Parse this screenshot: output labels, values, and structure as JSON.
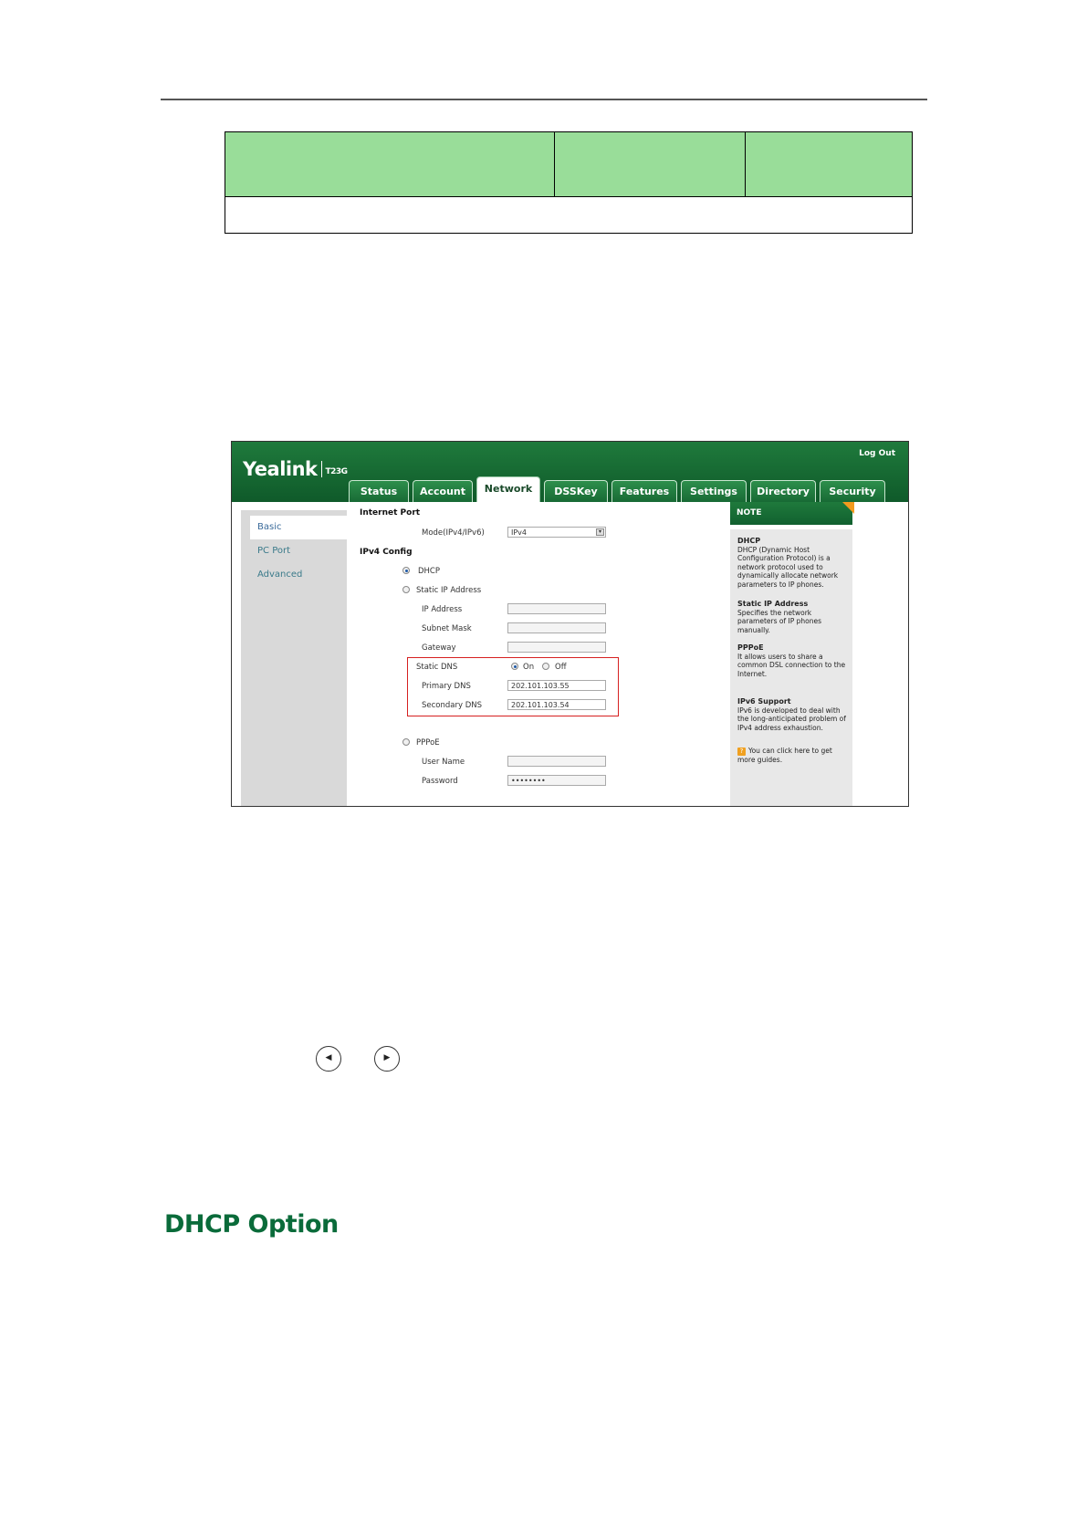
{
  "header_logo": {
    "brand": "Yealink",
    "model": "T23G"
  },
  "header": {
    "logout_label": "Log Out"
  },
  "tabs": [
    {
      "label": "Status"
    },
    {
      "label": "Account"
    },
    {
      "label": "Network"
    },
    {
      "label": "DSSKey"
    },
    {
      "label": "Features"
    },
    {
      "label": "Settings"
    },
    {
      "label": "Directory"
    },
    {
      "label": "Security"
    }
  ],
  "active_tab": "Network",
  "sidebar": {
    "items": [
      {
        "label": "Basic"
      },
      {
        "label": "PC Port"
      },
      {
        "label": "Advanced"
      }
    ]
  },
  "form": {
    "internet_port_label": "Internet Port",
    "mode_label": "Mode(IPv4/IPv6)",
    "mode_value": "IPv4",
    "ipv4_config_label": "IPv4 Config",
    "dhcp_label": "DHCP",
    "static_ip_label": "Static IP Address",
    "ip_address_label": "IP Address",
    "subnet_mask_label": "Subnet Mask",
    "gateway_label": "Gateway",
    "static_dns_label": "Static DNS",
    "on_label": "On",
    "off_label": "Off",
    "primary_dns_label": "Primary DNS",
    "primary_dns_value": "202.101.103.55",
    "secondary_dns_label": "Secondary DNS",
    "secondary_dns_value": "202.101.103.54",
    "pppoe_label": "PPPoE",
    "user_name_label": "User Name",
    "password_label": "Password",
    "password_value": "••••••••"
  },
  "note": {
    "title": "NOTE",
    "dhcp_title": "DHCP",
    "dhcp_text": "DHCP (Dynamic Host Configuration Protocol) is a network protocol used to dynamically allocate network parameters to IP phones.",
    "static_title": "Static IP Address",
    "static_text": "Specifies the network parameters of IP phones manually.",
    "pppoe_title": "PPPoE",
    "pppoe_text": "It allows users to share a common DSL connection to the Internet.",
    "ipv6_title": "IPv6 Support",
    "ipv6_text": "IPv6 is developed to deal with the long-anticipated problem of IPv4 address exhaustion.",
    "help_text": "You can click here to get more guides."
  },
  "section_heading": "DHCP Option",
  "colors": {
    "brand_green": "#1f7a3c",
    "table_header": "#99dd99",
    "highlight_red": "#d62020",
    "heading_green": "#0a6b3a"
  },
  "icons": {
    "left_key": "chevron-left-icon",
    "right_key": "chevron-right-icon"
  }
}
